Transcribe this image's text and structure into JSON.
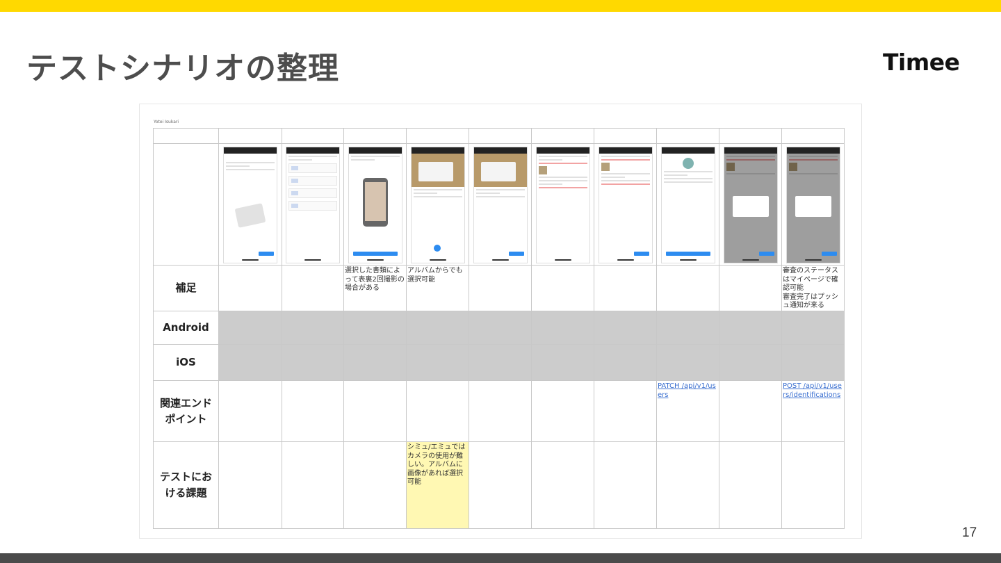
{
  "slide": {
    "title": "テストシナリオの整理",
    "logo": "Timee",
    "page_number": "17"
  },
  "sheet": {
    "caption": "Yotei Isukari",
    "rows": {
      "supplement": "補足",
      "android": "Android",
      "ios": "iOS",
      "endpoint": "関連エンド\nポイント",
      "issue": "テストにお\nける課題"
    },
    "supplement_notes": {
      "col3": "選択した書類によって表裏2回撮影の場合がある",
      "col4": "アルバムからでも選択可能",
      "col10": "審査のステータスはマイページで確認可能\n審査完了はプッシュ通知が来る"
    },
    "endpoints": {
      "col8": "PATCH /api/v1/users",
      "col10": "POST /api/v1/users/identifications"
    },
    "issues": {
      "col4": "シミュ/エミュではカメラの使用が難しい。アルバムに画像があれば選択可能"
    }
  },
  "colors": {
    "accent_yellow": "#ffd900",
    "bottom_bar": "#4b4b4b",
    "gray_cell": "#cccccc",
    "highlight_cell": "#fff8b3",
    "link": "#3a6fd0"
  }
}
